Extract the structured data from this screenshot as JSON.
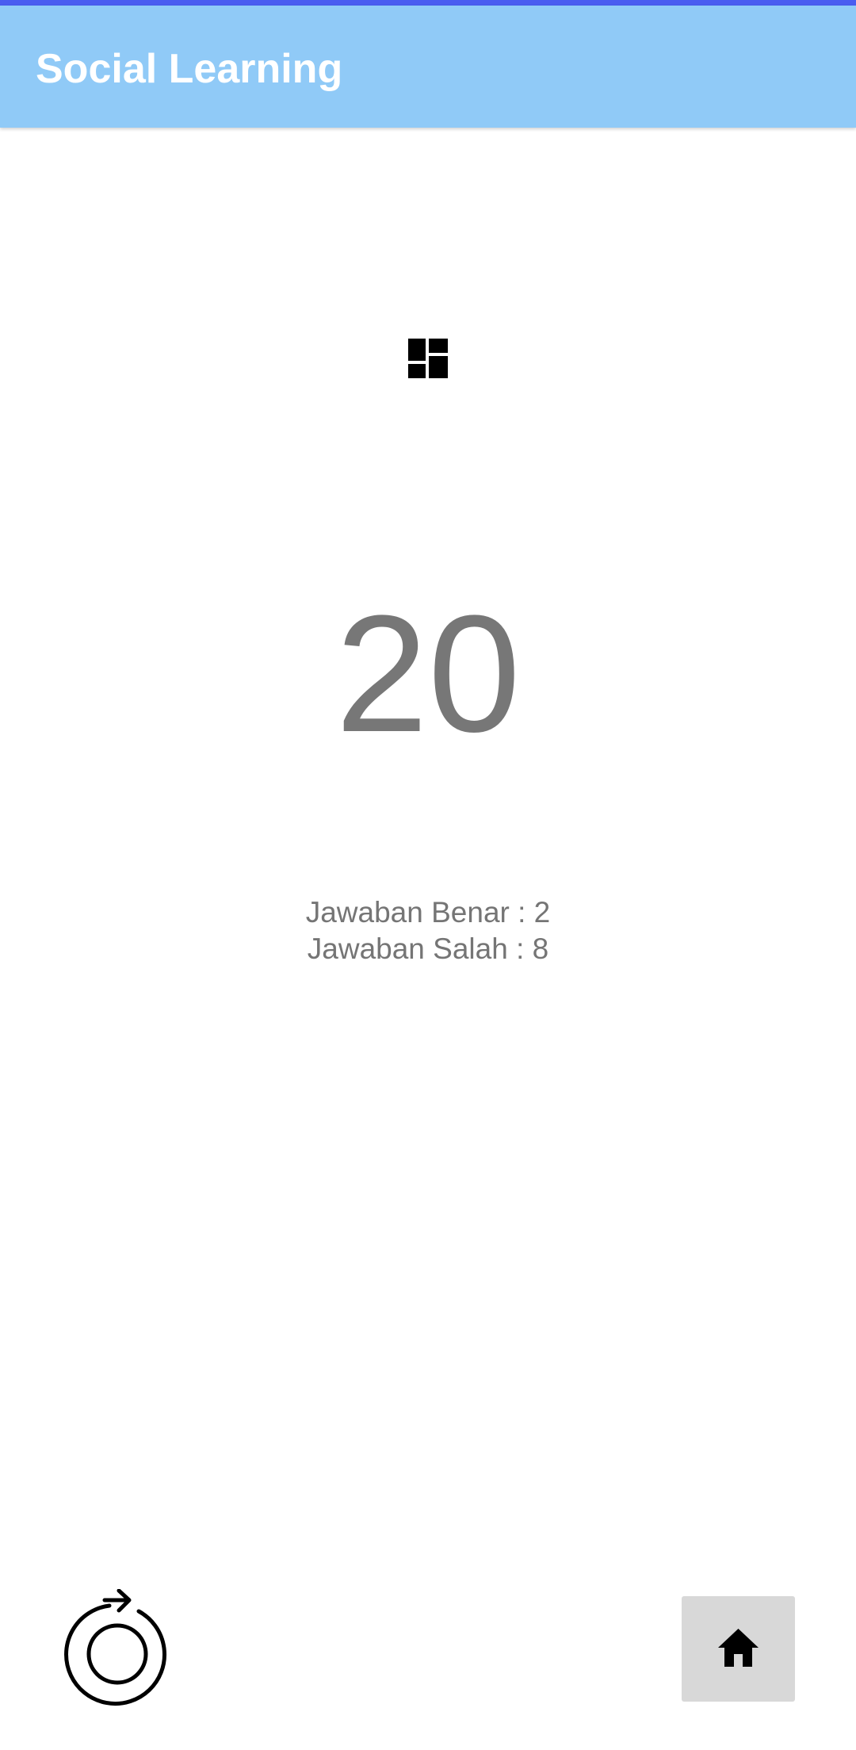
{
  "app_bar": {
    "title": "Social Learning",
    "background_color": "#90caf7",
    "status_strip_color": "#4a5cf0"
  },
  "main": {
    "icon": "dashboard-icon",
    "score": "20",
    "correct_answers_text": "Jawaban Benar : 2",
    "wrong_answers_text": "Jawaban Salah : 8"
  },
  "actions": {
    "retry_icon": "retry-icon",
    "home_icon": "home-icon"
  }
}
